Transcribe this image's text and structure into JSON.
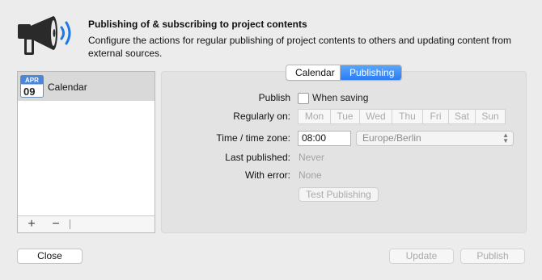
{
  "header": {
    "title": "Publishing of & subscribing to project contents",
    "subtitle": "Configure the actions for regular publishing of project contents to others and updating content from external sources.",
    "icon": "megaphone-icon"
  },
  "sidebar": {
    "items": [
      {
        "label": "Calendar",
        "icon": "calendar-icon",
        "icon_month": "APR",
        "icon_day": "09",
        "selected": true
      }
    ],
    "toolbar": {
      "add": "+",
      "remove": "−"
    }
  },
  "tabs": [
    {
      "label": "Calendar",
      "selected": false
    },
    {
      "label": "Publishing",
      "selected": true
    }
  ],
  "form": {
    "publish_label": "Publish",
    "when_saving_label": "When saving",
    "when_saving_checked": false,
    "regularly_on_label": "Regularly on:",
    "days": [
      "Mon",
      "Tue",
      "Wed",
      "Thu",
      "Fri",
      "Sat",
      "Sun"
    ],
    "time_label": "Time / time zone:",
    "time_value": "08:00",
    "timezone_value": "Europe/Berlin",
    "last_published_label": "Last published:",
    "last_published_value": "Never",
    "with_error_label": "With error:",
    "with_error_value": "None",
    "test_button": "Test Publishing"
  },
  "footer": {
    "close": "Close",
    "update": "Update",
    "publish": "Publish"
  },
  "colors": {
    "accent": "#2c7cf6",
    "background": "#ececec"
  }
}
